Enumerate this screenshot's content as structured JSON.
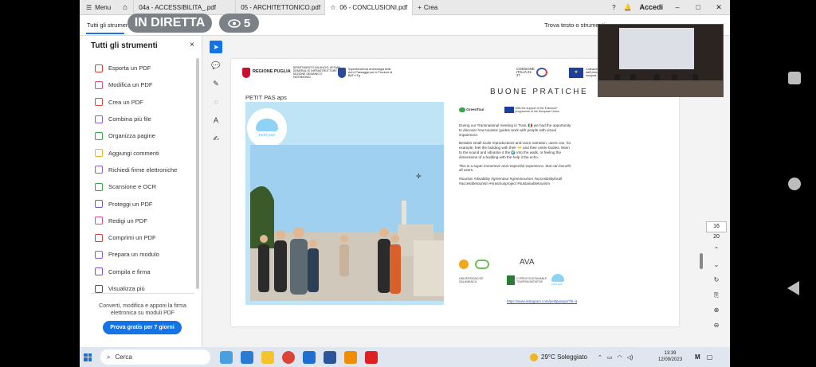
{
  "browser": {
    "menu_label": "Menu",
    "tabs": [
      {
        "label": "04a - ACCESSIBILITA_.pdf",
        "active": false
      },
      {
        "label": "05 - ARCHITETTONICO.pdf",
        "active": false
      },
      {
        "label": "06 - CONCLUSIONI.pdf",
        "active": true
      }
    ],
    "new_tab_label": "Crea",
    "sign_in_label": "Accedi"
  },
  "stream": {
    "live_label": "IN DIRETTA",
    "viewers": "5"
  },
  "toolbar2": {
    "tools_tab": "Tutti gli strumenti",
    "find_placeholder": "Trova testo o strumenti"
  },
  "tools_panel": {
    "title": "Tutti gli strumenti",
    "close": "×",
    "items": [
      {
        "label": "Esporta un PDF",
        "color": "#d93a3a"
      },
      {
        "label": "Modifica un PDF",
        "color": "#d94a8a"
      },
      {
        "label": "Crea un PDF",
        "color": "#e0453a"
      },
      {
        "label": "Combina più file",
        "color": "#8a5cd6"
      },
      {
        "label": "Organizza pagine",
        "color": "#3aa64a"
      },
      {
        "label": "Aggiungi commenti",
        "color": "#f0b323"
      },
      {
        "label": "Richiedi firme elettroniche",
        "color": "#8a5cd6"
      },
      {
        "label": "Scansione e OCR",
        "color": "#3aa64a"
      },
      {
        "label": "Proteggi un PDF",
        "color": "#7a4fd0"
      },
      {
        "label": "Redigi un PDF",
        "color": "#d94a8a"
      },
      {
        "label": "Comprimi un PDF",
        "color": "#d93a3a"
      },
      {
        "label": "Prepara un modulo",
        "color": "#8a5cd6"
      },
      {
        "label": "Compila e firma",
        "color": "#7a4fd0"
      },
      {
        "label": "Visualizza più",
        "color": "#555555"
      }
    ],
    "description": "Converti, modifica e apponi la firma elettronica su moduli PDF",
    "trial_button": "Prova gratis per 7 giorni"
  },
  "document": {
    "header_logo_1_title": "REGIONE PUGLIA",
    "header_logo_1_sub": "DIPARTIMENTO BILANCIO, AFFARI GENERALI E INFRASTRUTTURE SEZIONE DEMANIO E PATRIMONIO",
    "header_logo_2": "Soprintendenza Archeologia belle Arti e Paesaggio per le Province di BAT e Fg",
    "header_logo_3": "COESIONE ITALIA 21-27",
    "header_logo_4": "Cofinanziato dall'Unione europea",
    "section_title": "BUONE PRATICHE",
    "petit_title": "PETIT PAS aps",
    "petit_logo_text": "petit pas",
    "greentour_label": "GreenTour",
    "eu_program_note": "With the support of the Erasmus+ programme of the European Union",
    "paragraphs": [
      "During our Transnational meeting in Trani, 🇮🇹 we had the opportunity to discover how touristic guides work with people with visual impairment.",
      "Besides small scale reproductions and voice narration, users can, for example, feel the building with their 👐 and their entire bodies, listen to the sound and vibration it the 🌍 into the walls, or feeling the dimensions of a building with the help it the echo.",
      "This is a super immersive and respectful experience, that can benefit all users.",
      "#tourism #disability #greentour #greentourism #accesibilityforall #accesibletourism #erasmusproject #sustainabletourism"
    ],
    "partners": [
      "AVA",
      "UNIVERSIDAD DE SALAMANCA",
      "CYPRUS SUSTAINABLE TOURISM INITIATIVE",
      "petit pas"
    ],
    "link": "https://www.instagram.com/petitpasaps/?hl=it"
  },
  "rightnav": {
    "current_page": "16",
    "total_pages": "20"
  },
  "taskbar": {
    "search_label": "Cerca",
    "weather": "29°C Soleggiato",
    "time": "13:39",
    "date": "12/09/2023",
    "ext_label": "M"
  }
}
